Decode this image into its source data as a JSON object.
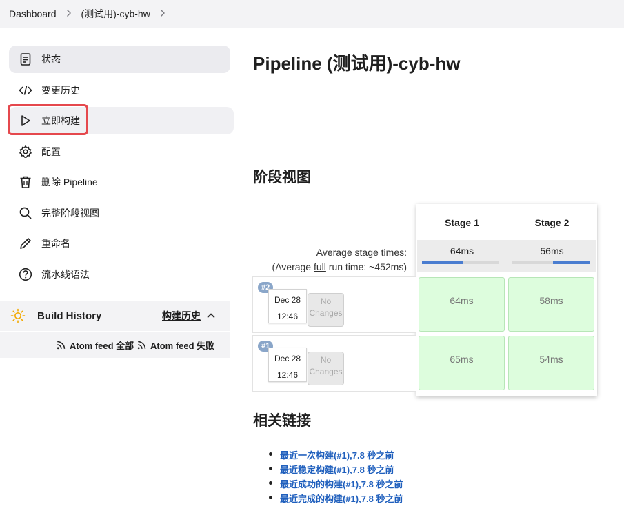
{
  "breadcrumb": {
    "items": [
      "Dashboard",
      "(测试用)-cyb-hw"
    ],
    "separator": ">"
  },
  "sidebar": {
    "items": [
      {
        "label": "状态",
        "icon": "status-icon"
      },
      {
        "label": "变更历史",
        "icon": "code-icon"
      },
      {
        "label": "立即构建",
        "icon": "play-icon"
      },
      {
        "label": "配置",
        "icon": "gear-icon"
      },
      {
        "label": "删除 Pipeline",
        "icon": "trash-icon"
      },
      {
        "label": "完整阶段视图",
        "icon": "search-icon"
      },
      {
        "label": "重命名",
        "icon": "pencil-icon"
      },
      {
        "label": "流水线语法",
        "icon": "help-icon"
      }
    ]
  },
  "build_history": {
    "title": "Build History",
    "zh_label": "构建历史",
    "feed_all": "Atom feed 全部",
    "feed_failed": "Atom feed 失败"
  },
  "main": {
    "title": "Pipeline (测试用)-cyb-hw",
    "stage_view_title": "阶段视图",
    "related_title": "相关链接"
  },
  "stage_view": {
    "stages": [
      "Stage 1",
      "Stage 2"
    ],
    "avg_label": "Average stage times:",
    "avg_full_prefix": "(Average ",
    "avg_full_word": "full",
    "avg_full_suffix": " run time: ~452ms)",
    "avg_times": [
      "64ms",
      "56ms"
    ],
    "avg_bar_fraction": [
      0.53,
      0.47
    ],
    "runs": [
      {
        "badge": "#2",
        "date": "Dec 28",
        "time": "12:46",
        "changes": "No Changes",
        "cells": [
          "64ms",
          "58ms"
        ]
      },
      {
        "badge": "#1",
        "date": "Dec 28",
        "time": "12:46",
        "changes": "No Changes",
        "cells": [
          "65ms",
          "54ms"
        ]
      }
    ]
  },
  "related_links": [
    "最近一次构建(#1),7.8 秒之前",
    "最近稳定构建(#1),7.8 秒之前",
    "最近成功的构建(#1),7.8 秒之前",
    "最近完成的构建(#1),7.8 秒之前"
  ],
  "colors": {
    "link": "#1f5fbd",
    "highlight": "#e5484d",
    "success_cell": "#ddfddd",
    "progress": "#4a7dd0"
  }
}
